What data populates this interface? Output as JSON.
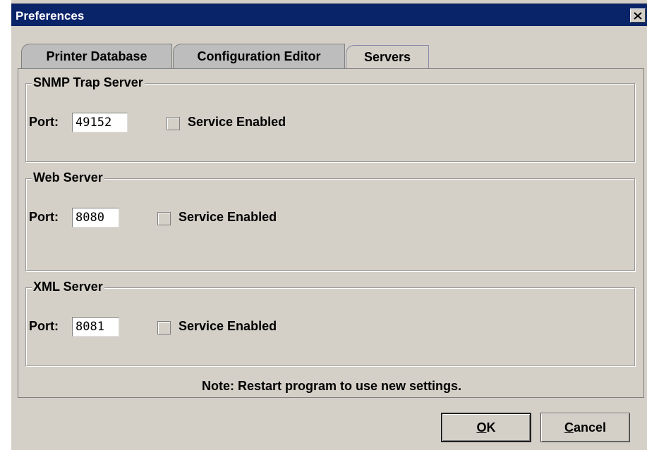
{
  "window": {
    "title": "Preferences",
    "close_icon": "close-x-icon"
  },
  "tabs": [
    {
      "label": "Printer Database",
      "active": false
    },
    {
      "label": "Configuration Editor",
      "active": false
    },
    {
      "label": "Servers",
      "active": true
    }
  ],
  "servers": [
    {
      "title": "SNMP Trap Server",
      "port_label": "Port:",
      "port_value": "49152",
      "service_label": "Service Enabled",
      "enabled": false
    },
    {
      "title": "Web Server",
      "port_label": "Port:",
      "port_value": "8080",
      "service_label": "Service Enabled",
      "enabled": false
    },
    {
      "title": "XML Server",
      "port_label": "Port:",
      "port_value": "8081",
      "service_label": "Service Enabled",
      "enabled": false
    }
  ],
  "note": "Note: Restart program to use new settings.",
  "buttons": {
    "ok": {
      "mnemonic": "O",
      "rest": "K"
    },
    "cancel": {
      "mnemonic": "C",
      "rest": "ancel"
    }
  }
}
